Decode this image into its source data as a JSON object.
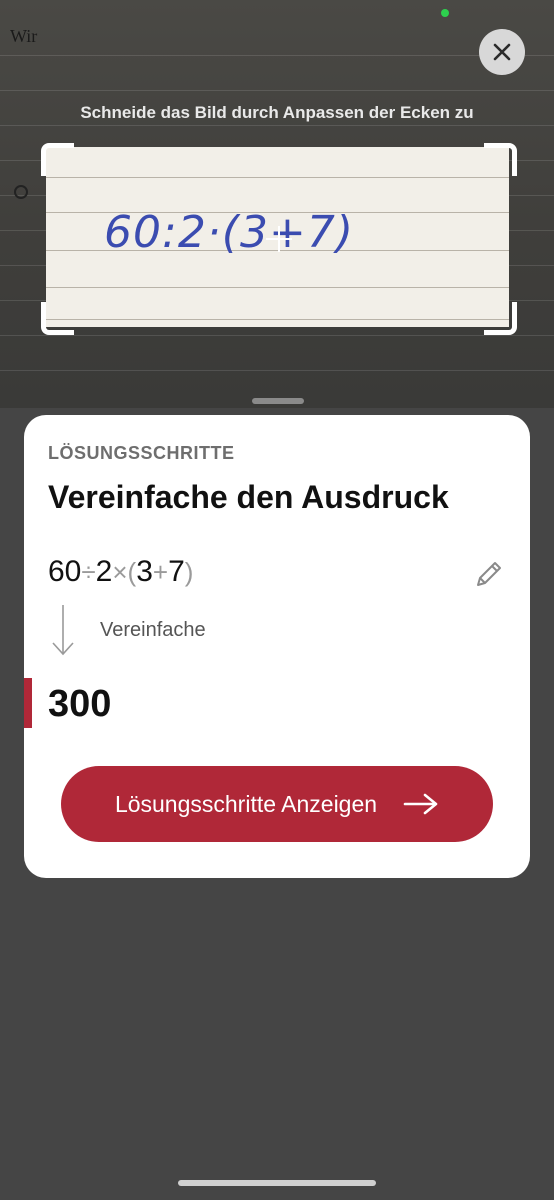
{
  "camera": {
    "margin_text": "Wir",
    "hint": "Schneide das Bild durch Anpassen der Ecken zu",
    "handwriting": "60:2·(3+7)"
  },
  "card": {
    "section_label": "LÖSUNGSSCHRITTE",
    "title": "Vereinfache den Ausdruck",
    "expression": {
      "a": "60",
      "div": "÷",
      "b": "2",
      "mul": "×",
      "lparen": "(",
      "c": "3",
      "plus": "+",
      "d": "7",
      "rparen": ")"
    },
    "step_label": "Vereinfache",
    "result": "300",
    "cta_label": "Lösungsschritte Anzeigen"
  },
  "colors": {
    "accent": "#b02838",
    "background": "#454545",
    "status_dot": "#2dd04e"
  },
  "icons": {
    "close": "close-icon",
    "edit": "pencil-icon",
    "step": "arrow-down-icon",
    "cta": "arrow-right-icon"
  }
}
